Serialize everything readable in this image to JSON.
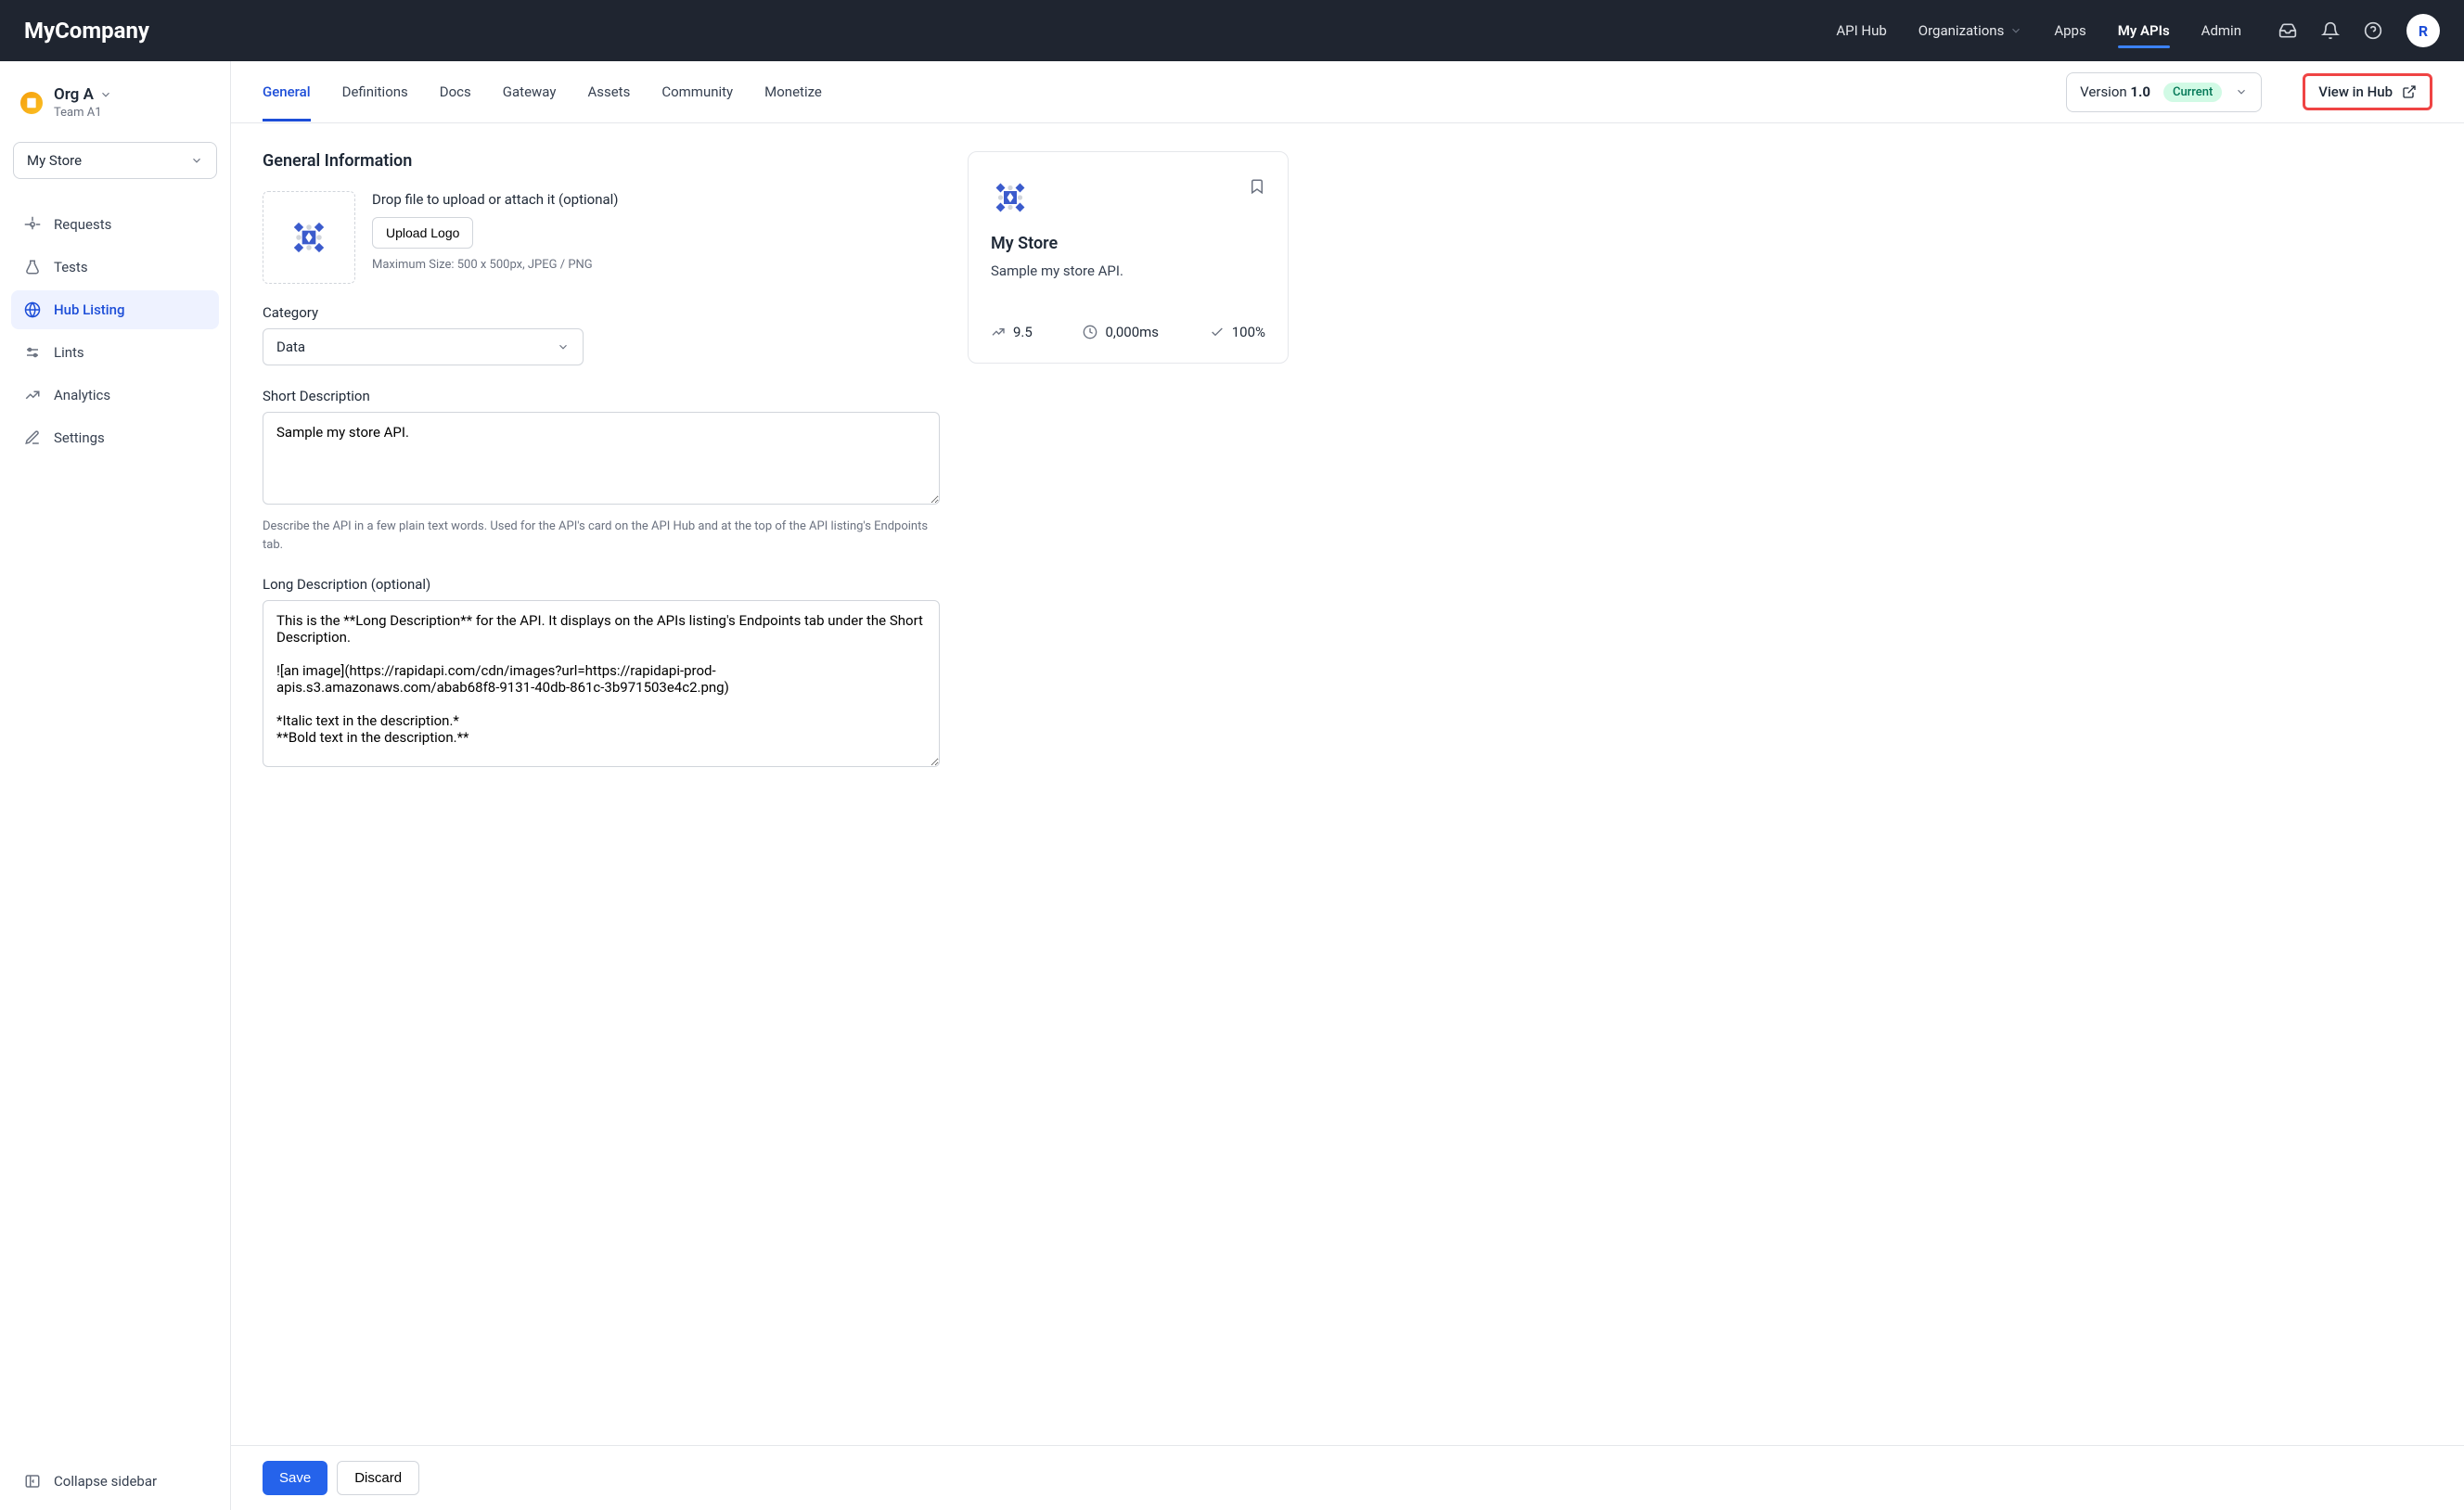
{
  "brand": "MyCompany",
  "topnav": {
    "apihub": "API Hub",
    "organizations": "Organizations",
    "apps": "Apps",
    "myapis": "My APIs",
    "admin": "Admin"
  },
  "avatar_letter": "R",
  "sidebar": {
    "org_name": "Org A",
    "team": "Team A1",
    "store_select": "My Store",
    "items": {
      "requests": "Requests",
      "tests": "Tests",
      "hub_listing": "Hub Listing",
      "lints": "Lints",
      "analytics": "Analytics",
      "settings": "Settings"
    },
    "collapse": "Collapse sidebar"
  },
  "tabs": {
    "general": "General",
    "definitions": "Definitions",
    "docs": "Docs",
    "gateway": "Gateway",
    "assets": "Assets",
    "community": "Community",
    "monetize": "Monetize"
  },
  "version": {
    "label_prefix": "Version ",
    "number": "1.0",
    "badge": "Current"
  },
  "view_in_hub": "View in Hub",
  "form": {
    "section_title": "General Information",
    "upload_hint": "Drop file to upload or attach it (optional)",
    "upload_button": "Upload Logo",
    "upload_constraint": "Maximum Size: 500 x 500px, JPEG / PNG",
    "category_label": "Category",
    "category_value": "Data",
    "short_desc_label": "Short Description",
    "short_desc_value": "Sample my store API.",
    "short_desc_help": "Describe the API in a few plain text words. Used for the API's card on the API Hub and at the top of the API listing's Endpoints tab.",
    "long_desc_label": "Long Description (optional)",
    "long_desc_value": "This is the **Long Description** for the API. It displays on the APIs listing's Endpoints tab under the Short Description.\n\n![an image](https://rapidapi.com/cdn/images?url=https://rapidapi-prod-apis.s3.amazonaws.com/abab68f8-9131-40db-861c-3b971503e4c2.png)\n\n*Italic text in the description.*\n**Bold text in the description.**"
  },
  "preview": {
    "title": "My Store",
    "subtitle": "Sample my store API.",
    "score": "9.5",
    "latency": "0,000ms",
    "success": "100%"
  },
  "footer": {
    "save": "Save",
    "discard": "Discard"
  }
}
